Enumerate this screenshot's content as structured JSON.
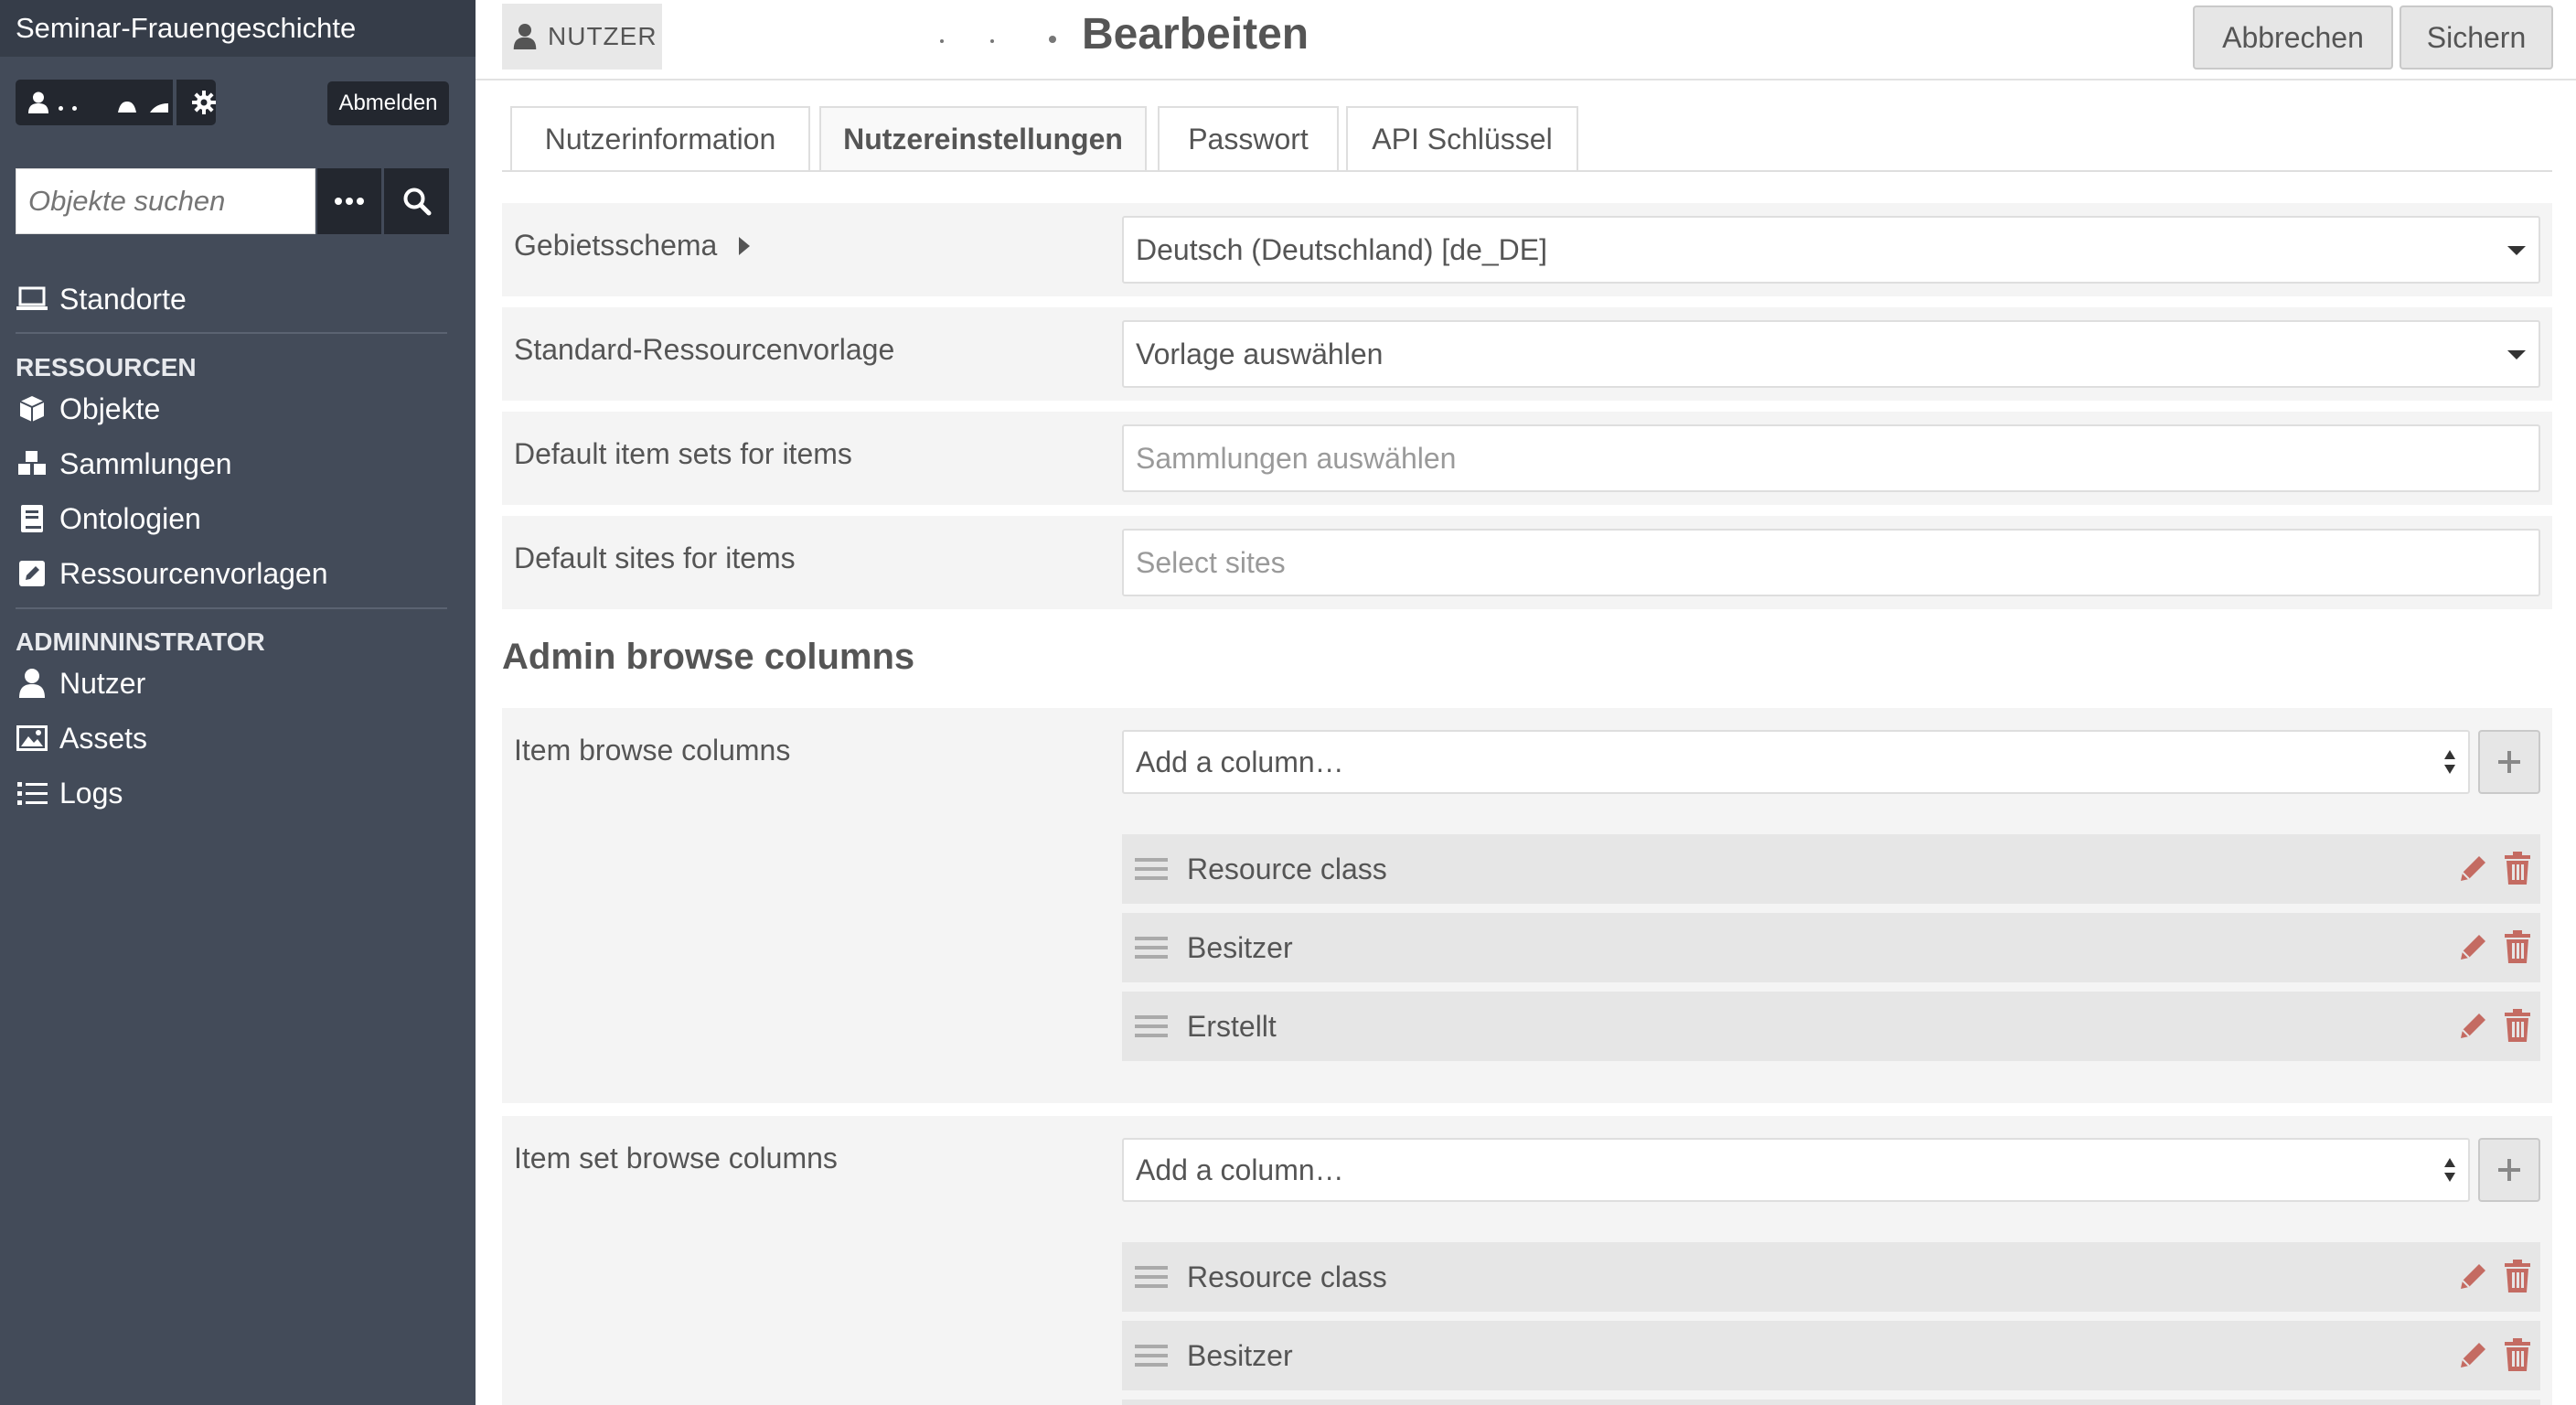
{
  "site_title": "Seminar-Frauengeschichte",
  "logout_label": "Abmelden",
  "search": {
    "placeholder": "Objekte suchen"
  },
  "nav": {
    "sites": "Standorte",
    "resources_heading": "RESSOURCEN",
    "resources": [
      "Objekte",
      "Sammlungen",
      "Ontologien",
      "Ressourcenvorlagen"
    ],
    "admin_heading": "ADMINNINSTRATOR",
    "admin": [
      "Nutzer",
      "Assets",
      "Logs"
    ]
  },
  "header": {
    "crumb": "NUTZER",
    "title": "Bearbeiten",
    "cancel": "Abbrechen",
    "save": "Sichern"
  },
  "tabs": [
    "Nutzerinformation",
    "Nutzereinstellungen",
    "Passwort",
    "API Schlüssel"
  ],
  "active_tab": "Nutzereinstellungen",
  "fields": {
    "locale": {
      "label": "Gebietsschema",
      "value": "Deutsch (Deutschland) [de_DE]"
    },
    "template": {
      "label": "Standard-Ressourcenvorlage",
      "value": "Vorlage auswählen"
    },
    "item_sets": {
      "label": "Default item sets for items",
      "placeholder": "Sammlungen auswählen"
    },
    "sites": {
      "label": "Default sites for items",
      "placeholder": "Select sites"
    }
  },
  "browse_section": {
    "heading": "Admin browse columns",
    "item_columns": {
      "label": "Item browse columns",
      "select": "Add a column…",
      "columns": [
        "Resource class",
        "Besitzer",
        "Erstellt"
      ]
    },
    "itemset_columns": {
      "label": "Item set browse columns",
      "select": "Add a column…",
      "columns": [
        "Resource class",
        "Besitzer"
      ]
    }
  },
  "colors": {
    "sidebar": "#434b59",
    "sidebar_header": "#363d49",
    "dark_button": "#23272f",
    "danger_icon": "#c46b62"
  }
}
